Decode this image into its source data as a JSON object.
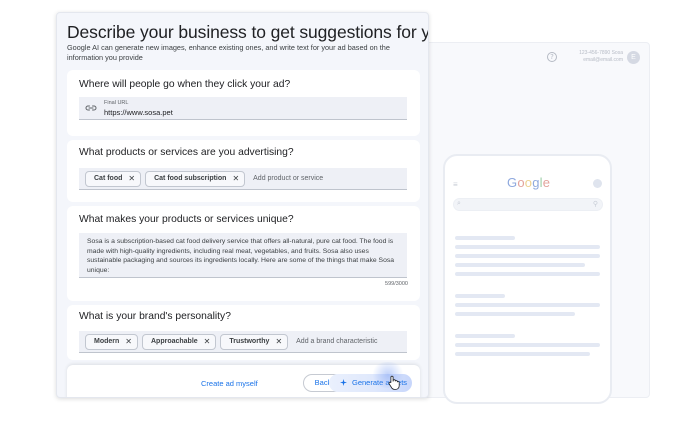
{
  "preview": {
    "account_phone": "123-456-7890 Sosa",
    "account_email": "email@email.com",
    "avatar_letter": "E",
    "help_glyph": "?",
    "search_engine_logo": "Google"
  },
  "panel": {
    "title": "Describe your business to get suggestions for your ads",
    "description": "Google AI can generate new images, enhance existing ones, and write text for your ad based on the information you provide"
  },
  "destination": {
    "question": "Where will people go when they click your ad?",
    "field_label": "Final URL",
    "field_value": "https://www.sosa.pet"
  },
  "products": {
    "question": "What products or services are you advertising?",
    "chips": [
      "Cat food",
      "Cat food subscription"
    ],
    "add_placeholder": "Add product or service"
  },
  "unique": {
    "question": "What makes your products or services unique?",
    "text": "Sosa is a subscription-based cat food delivery service that offers all-natural, pure cat food. The food is made with high-quality ingredients, including real meat, vegetables, and fruits. Sosa also uses sustainable packaging and sources its ingredients locally. Here are some of the things that make Sosa unique:",
    "counter": "599/3000"
  },
  "personality": {
    "question": "What is your brand's personality?",
    "chips": [
      "Modern",
      "Approachable",
      "Trustworthy"
    ],
    "add_placeholder": "Add a brand characteristic"
  },
  "footer": {
    "create_label": "Create ad myself",
    "back_label": "Back",
    "generate_label": "Generate assets"
  },
  "icons": {
    "chip_remove": "✕",
    "menu": "≡",
    "search": "⌕",
    "mic": "⚲"
  },
  "colors": {
    "accent": "#1a73e8",
    "panel_bg": "#f4f6fb",
    "field_bg": "#eef0f6"
  }
}
